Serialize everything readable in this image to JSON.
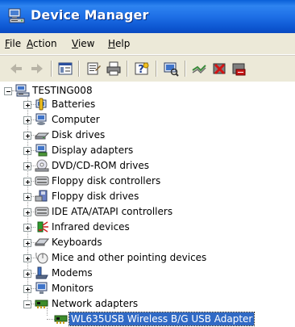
{
  "window": {
    "title": "Device Manager",
    "icon": "device-manager-icon"
  },
  "menu": {
    "items": [
      {
        "label": "File",
        "u": "F",
        "rest": "ile"
      },
      {
        "label": "Action",
        "u": "A",
        "rest": "ction"
      },
      {
        "label": "View",
        "u": "V",
        "rest": "iew"
      },
      {
        "label": "Help",
        "u": "H",
        "rest": "elp"
      }
    ]
  },
  "toolbar": {
    "buttons": [
      "back-icon",
      "forward-icon",
      "show-hide-console-tree-icon",
      "properties-icon",
      "print-icon",
      "help-icon",
      "scan-hardware-icon",
      "update-driver-icon",
      "uninstall-icon",
      "disable-icon"
    ]
  },
  "tree": {
    "root": {
      "label": "TESTING008",
      "icon": "computer-icon"
    },
    "items": [
      {
        "label": "Batteries",
        "icon": "battery-icon",
        "expanded": false
      },
      {
        "label": "Computer",
        "icon": "computer-icon",
        "expanded": false
      },
      {
        "label": "Disk drives",
        "icon": "disk-drive-icon",
        "expanded": false
      },
      {
        "label": "Display adapters",
        "icon": "display-adapter-icon",
        "expanded": false
      },
      {
        "label": "DVD/CD-ROM drives",
        "icon": "cd-drive-icon",
        "expanded": false
      },
      {
        "label": "Floppy disk controllers",
        "icon": "floppy-controller-icon",
        "expanded": false
      },
      {
        "label": "Floppy disk drives",
        "icon": "floppy-drive-icon",
        "expanded": false
      },
      {
        "label": "IDE ATA/ATAPI controllers",
        "icon": "ide-controller-icon",
        "expanded": false
      },
      {
        "label": "Infrared devices",
        "icon": "infrared-icon",
        "expanded": false
      },
      {
        "label": "Keyboards",
        "icon": "keyboard-icon",
        "expanded": false
      },
      {
        "label": "Mice and other pointing devices",
        "icon": "mouse-icon",
        "expanded": false
      },
      {
        "label": "Modems",
        "icon": "modem-icon",
        "expanded": false
      },
      {
        "label": "Monitors",
        "icon": "monitor-icon",
        "expanded": false
      },
      {
        "label": "Network adapters",
        "icon": "network-adapter-icon",
        "expanded": true
      }
    ],
    "child": {
      "label": "WL635USB Wireless B/G USB Adapter",
      "icon": "network-card-icon",
      "selected": true
    }
  },
  "colors": {
    "titlebar": "#0a5fd8",
    "selection": "#316ac5",
    "chrome": "#ece9d8"
  }
}
